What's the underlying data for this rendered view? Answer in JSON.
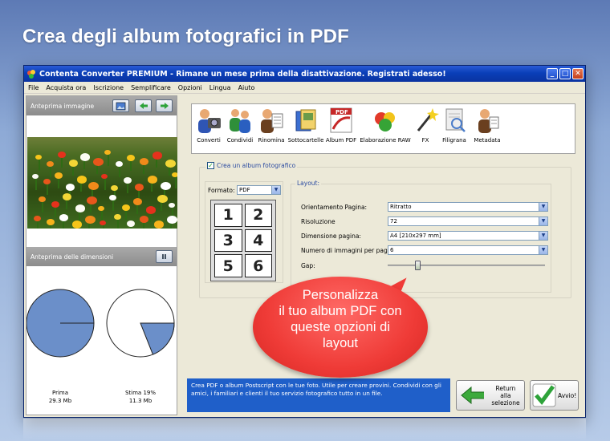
{
  "headline": "Crea degli album fotografici in PDF",
  "window": {
    "title": "Contenta Converter PREMIUM  - Rimane un mese prima della disattivazione. Registrati adesso!",
    "controls": {
      "minimize": "_",
      "maximize": "□",
      "close": "✕"
    }
  },
  "menu": [
    "File",
    "Acquista ora",
    "Iscrizione",
    "Semplificare",
    "Opzioni",
    "Lingua",
    "Aiuto"
  ],
  "left_panel": {
    "preview_title": "Anteprima immagine",
    "size_preview_title": "Anteprima delle dimensioni",
    "pause_label": "II",
    "before": {
      "label": "Prima",
      "size": "29.3 Mb",
      "fraction": 1.0
    },
    "after": {
      "label": "Stima 19%",
      "size": "11.3 Mb",
      "fraction": 0.19
    }
  },
  "tools": [
    {
      "label": "Converti",
      "icon": "camera-person-icon"
    },
    {
      "label": "Condividi",
      "icon": "people-share-icon"
    },
    {
      "label": "Rinomina",
      "icon": "person-document-icon"
    },
    {
      "label": "Sottocartelle",
      "icon": "folders-icon"
    },
    {
      "label": "Album PDF",
      "icon": "pdf-album-icon",
      "selected": true
    },
    {
      "label": "Elaborazione RAW",
      "icon": "color-dots-icon"
    },
    {
      "label": "FX",
      "icon": "magic-wand-icon"
    },
    {
      "label": "Filigrana",
      "icon": "watermark-icon"
    },
    {
      "label": "Metadata",
      "icon": "person-info-icon"
    }
  ],
  "album": {
    "checkbox_label": "Crea un album fotografico",
    "checked": true,
    "format_label": "Formato:",
    "format_value": "PDF",
    "grid_numbers": [
      "1",
      "2",
      "3",
      "4",
      "5",
      "6"
    ],
    "layout_title": "Layout:",
    "fields": {
      "orientation": {
        "label": "Orientamento Pagina:",
        "value": "Ritratto"
      },
      "resolution": {
        "label": "Risoluzione",
        "value": "72"
      },
      "page_size": {
        "label": "Dimensione pagina:",
        "value": "A4 [210x297 mm]"
      },
      "images_per_page": {
        "label": "Numero di immagini per pagina:",
        "value": "6"
      },
      "gap": {
        "label": "Gap:",
        "level": 0.19
      }
    }
  },
  "info_text": "Crea PDF o album Postscript con le tue foto. Utile per creare provini. Condividi con gli amici, i familiari e clienti il tuo servizio fotografico tutto in un file.",
  "buttons": {
    "return_line1": "Return",
    "return_line2": "alla selezione",
    "go": "Avvio!"
  },
  "callout": {
    "line1": "Personalizza",
    "line2": "il tuo album PDF con",
    "line3": "queste opzioni di",
    "line4": "layout"
  },
  "colors": {
    "pie_fill": "#6b8fc9",
    "callout": "#ef3b37",
    "info_bg": "#1f5fc9",
    "title_bar": "#0a3fb8"
  }
}
